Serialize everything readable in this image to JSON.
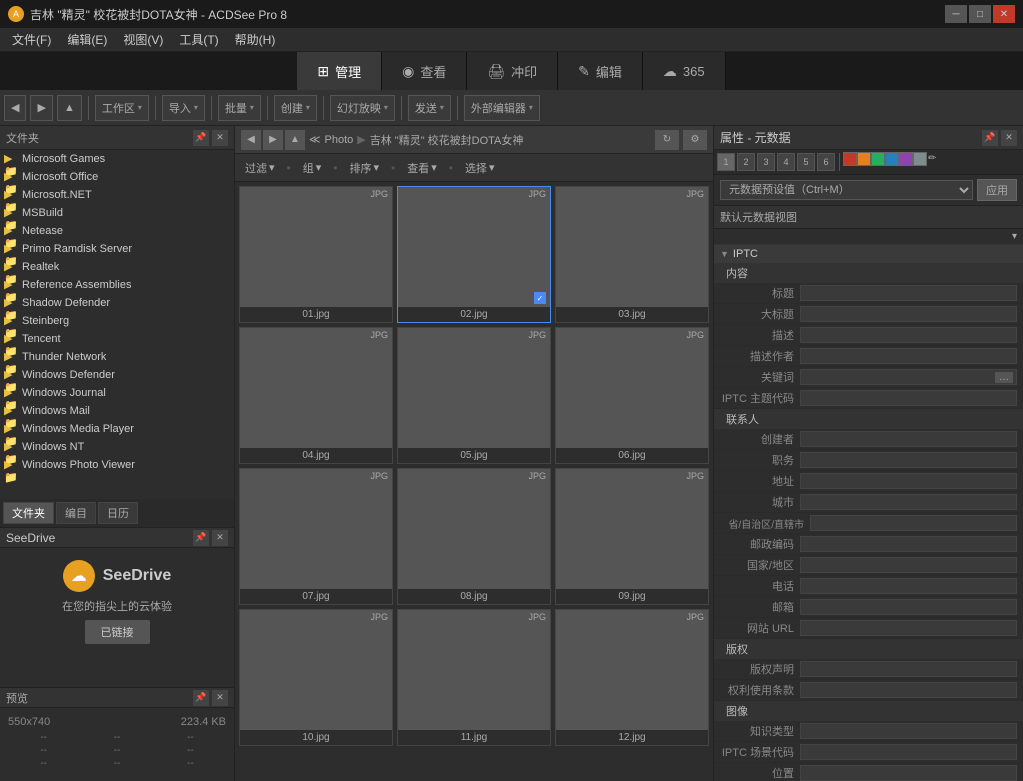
{
  "window": {
    "title": "吉林 \"精灵\" 校花被封DOTA女神 - ACDSee Pro 8"
  },
  "menubar": {
    "items": [
      "文件(F)",
      "编辑(E)",
      "视图(V)",
      "工具(T)",
      "帮助(H)"
    ]
  },
  "topnav": {
    "buttons": [
      {
        "label": "管理",
        "icon": "grid"
      },
      {
        "label": "查看",
        "icon": "eye"
      },
      {
        "label": "冲印",
        "icon": "print"
      },
      {
        "label": "编辑",
        "icon": "edit"
      },
      {
        "label": "365",
        "icon": "cloud"
      }
    ]
  },
  "toolbar": {
    "workspace_label": "工作区",
    "workspace_arrow": "▾",
    "import_label": "导入",
    "import_arrow": "▾",
    "batch_label": "批量",
    "batch_arrow": "▾",
    "create_label": "创建",
    "create_arrow": "▾",
    "slideshow_label": "幻灯放映",
    "slideshow_arrow": "▾",
    "send_label": "发送",
    "send_arrow": "▾",
    "ext_editor_label": "外部编辑器",
    "ext_editor_arrow": "▾"
  },
  "sidebar": {
    "header": "文件夹",
    "tabs": [
      "文件夹",
      "编目",
      "日历"
    ],
    "tree_items": [
      "Microsoft Games",
      "Microsoft Office",
      "Microsoft.NET",
      "MSBuild",
      "Netease",
      "Primo Ramdisk Server",
      "Realtek",
      "Reference Assemblies",
      "Shadow Defender",
      "Steinberg",
      "Tencent",
      "Thunder Network",
      "Windows Defender",
      "Windows Journal",
      "Windows Mail",
      "Windows Media Player",
      "Windows NT",
      "Windows Photo Viewer"
    ]
  },
  "seedrive": {
    "header": "SeeDrive",
    "logo_text": "SeeDrive",
    "description": "在您的指尖上的云体验",
    "connected_label": "已链接"
  },
  "preview": {
    "header": "预览",
    "size_label": "550x740",
    "filesize_label": "223.4 KB",
    "stats": [
      "--",
      "--",
      "--",
      "--",
      "--",
      "--",
      "--",
      "--",
      "--"
    ]
  },
  "content": {
    "breadcrumb": {
      "parts": [
        "Photo",
        "吉林 \"精灵\" 校花被封DOTA女神"
      ]
    },
    "toolbar": {
      "filter_label": "过滤",
      "group_label": "组",
      "sort_label": "排序",
      "view_label": "查看",
      "select_label": "选择",
      "arrows": [
        "▾",
        "▾",
        "▾",
        "▾",
        "▾"
      ]
    },
    "photos": [
      {
        "filename": "01.jpg",
        "badge": "JPG",
        "selected": false,
        "style_class": "photo-girl-1"
      },
      {
        "filename": "02.jpg",
        "badge": "JPG",
        "selected": true,
        "style_class": "photo-girl-2"
      },
      {
        "filename": "03.jpg",
        "badge": "JPG",
        "selected": false,
        "style_class": "photo-girl-3"
      },
      {
        "filename": "04.jpg",
        "badge": "JPG",
        "selected": false,
        "style_class": "photo-girl-4"
      },
      {
        "filename": "05.jpg",
        "badge": "JPG",
        "selected": false,
        "style_class": "photo-girl-5"
      },
      {
        "filename": "06.jpg",
        "badge": "JPG",
        "selected": false,
        "style_class": "photo-girl-6"
      },
      {
        "filename": "07.jpg",
        "badge": "JPG",
        "selected": false,
        "style_class": "photo-girl-7"
      },
      {
        "filename": "08.jpg",
        "badge": "JPG",
        "selected": false,
        "style_class": "photo-girl-8"
      },
      {
        "filename": "09.jpg",
        "badge": "JPG",
        "selected": false,
        "style_class": "photo-girl-9"
      },
      {
        "filename": "10.jpg",
        "badge": "JPG",
        "selected": false,
        "style_class": "photo-girl-10"
      },
      {
        "filename": "11.jpg",
        "badge": "JPG",
        "selected": false,
        "style_class": "photo-girl-1"
      },
      {
        "filename": "12.jpg",
        "badge": "JPG",
        "selected": false,
        "style_class": "photo-girl-2"
      }
    ]
  },
  "metadata": {
    "header": "属性 - 元数据",
    "tab_numbers": [
      "1",
      "2",
      "3",
      "4",
      "5",
      "6"
    ],
    "color_swatches": [
      "#c0392b",
      "#e67e22",
      "#27ae60",
      "#2980b9",
      "#8e44ad",
      "#7f8c8d"
    ],
    "preset_label": "元数据预设值（Ctrl+M）",
    "apply_label": "应用",
    "view_label": "默认元数据视图",
    "sections": [
      {
        "name": "IPTC",
        "groups": [
          {
            "name": "内容",
            "fields": [
              {
                "label": "标题",
                "value": ""
              },
              {
                "label": "大标题",
                "value": ""
              },
              {
                "label": "描述",
                "value": ""
              },
              {
                "label": "描述作者",
                "value": ""
              },
              {
                "label": "关键词",
                "value": "",
                "has_btn": true
              },
              {
                "label": "IPTC 主题代码",
                "value": ""
              }
            ]
          },
          {
            "name": "联系人",
            "fields": [
              {
                "label": "创建者",
                "value": ""
              },
              {
                "label": "职务",
                "value": ""
              },
              {
                "label": "地址",
                "value": ""
              },
              {
                "label": "城市",
                "value": ""
              },
              {
                "label": "省/自治区/直辖市",
                "value": ""
              },
              {
                "label": "邮政编码",
                "value": ""
              },
              {
                "label": "国家/地区",
                "value": ""
              },
              {
                "label": "电话",
                "value": ""
              },
              {
                "label": "邮箱",
                "value": ""
              },
              {
                "label": "网站 URL",
                "value": ""
              }
            ]
          },
          {
            "name": "版权",
            "fields": [
              {
                "label": "版权声明",
                "value": ""
              },
              {
                "label": "权利使用条款",
                "value": ""
              }
            ]
          },
          {
            "name": "图像",
            "fields": [
              {
                "label": "知识类型",
                "value": ""
              },
              {
                "label": "IPTC 场景代码",
                "value": ""
              },
              {
                "label": "位置",
                "value": ""
              }
            ]
          }
        ]
      }
    ]
  }
}
